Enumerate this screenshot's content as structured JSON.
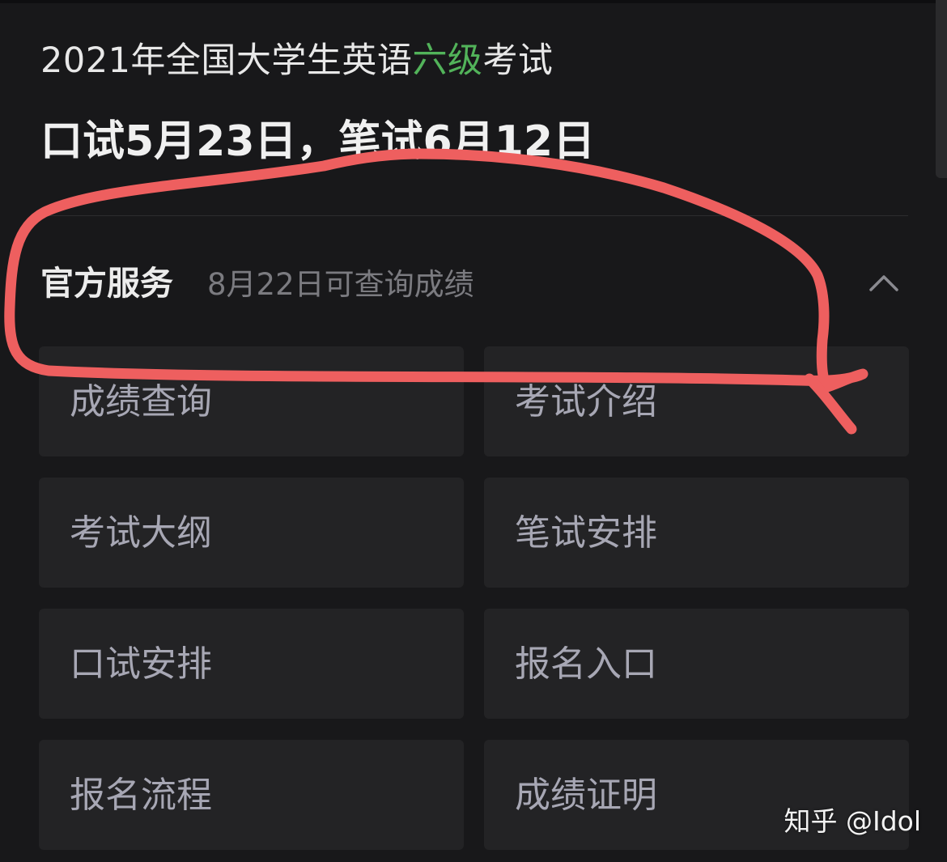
{
  "header": {
    "title_prefix": "2021年全国大学生英语",
    "title_highlight": "六级",
    "title_suffix": "考试",
    "dates": "口试5月23日，笔试6月12日"
  },
  "section": {
    "title": "官方服务",
    "subtitle": "8月22日可查询成绩",
    "collapse_icon": "chevron-up-icon"
  },
  "tiles": [
    {
      "label": "成绩查询"
    },
    {
      "label": "考试介绍"
    },
    {
      "label": "考试大纲"
    },
    {
      "label": "笔试安排"
    },
    {
      "label": "口试安排"
    },
    {
      "label": "报名入口"
    },
    {
      "label": "报名流程"
    },
    {
      "label": "成绩证明"
    }
  ],
  "watermark": "知乎 @Idol",
  "colors": {
    "background": "#18181a",
    "tile": "#232325",
    "highlight": "#52b35a",
    "annotation": "#ee5f5f",
    "tile_text": "#a7a7b4",
    "subtitle_text": "#7b7b80"
  }
}
